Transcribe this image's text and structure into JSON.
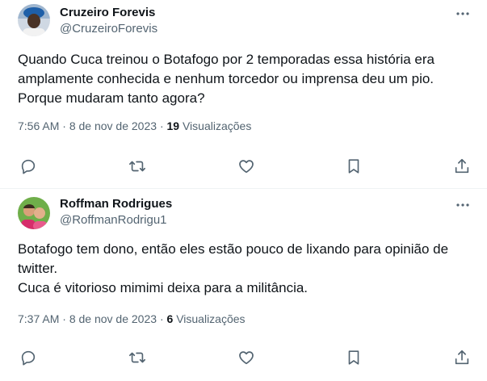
{
  "tweets": [
    {
      "name": "Cruzeiro Forevis",
      "handle": "@CruzeiroForevis",
      "text": "Quando Cuca treinou o Botafogo por 2 temporadas essa história era\namplamente conhecida e nenhum torcedor ou imprensa deu um pio.\nPorque mudaram tanto agora?",
      "time": "7:56 AM",
      "separator": "·",
      "date": "8 de nov de 2023",
      "views_count": "19",
      "views_label": "Visualizações"
    },
    {
      "name": "Roffman Rodrigues",
      "handle": "@RoffmanRodrigu1",
      "text": "Botafogo tem dono, então eles estão pouco de lixando para opinião de\ntwitter.\nCuca é vitorioso mimimi deixa para a militância.",
      "time": "7:37 AM",
      "separator": "·",
      "date": "8 de nov de 2023",
      "views_count": "6",
      "views_label": "Visualizações"
    }
  ],
  "icons": {
    "more": "more-icon",
    "reply": "reply-icon",
    "retweet": "retweet-icon",
    "like": "heart-icon",
    "bookmark": "bookmark-icon",
    "share": "share-icon"
  },
  "colors": {
    "primary_text": "#0f1419",
    "secondary_text": "#536471",
    "divider": "#eff3f4"
  }
}
